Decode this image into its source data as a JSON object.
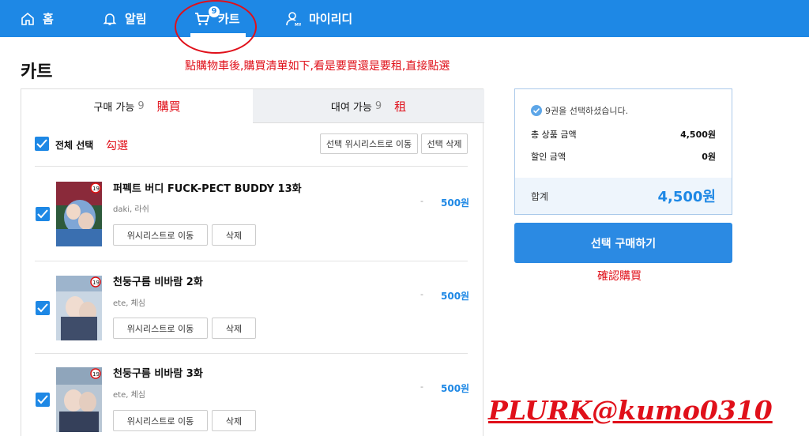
{
  "nav": {
    "home": "홈",
    "alarm": "알림",
    "cart": "카트",
    "cart_badge": "9",
    "my": "마이리디"
  },
  "page": {
    "title": "카트",
    "annotation_top": "點購物車後,購買清單如下,看是要買還是要租,直接點選"
  },
  "tabs": [
    {
      "label": "구매 가능",
      "count": "9",
      "annotation": "購買"
    },
    {
      "label": "대여 가능",
      "count": "9",
      "annotation": "租"
    }
  ],
  "toolbar": {
    "select_all": "전체 선택",
    "annotation_check": "勾選",
    "move_wishlist": "선택 위시리스트로 이동",
    "delete_selected": "선택 삭제"
  },
  "items": [
    {
      "title": "퍼펙트 버디 FUCK-PECT BUDDY 13화",
      "author": "daki, 라쉬",
      "dash": "-",
      "price": "500원",
      "wish_btn": "위시리스트로 이동",
      "delete_btn": "삭제"
    },
    {
      "title": "천둥구름 비바람 2화",
      "author": "ete, 체심",
      "dash": "-",
      "price": "500원",
      "wish_btn": "위시리스트로 이동",
      "delete_btn": "삭제"
    },
    {
      "title": "천둥구름 비바람 3화",
      "author": "ete, 체심",
      "dash": "-",
      "price": "500원",
      "wish_btn": "위시리스트로 이동",
      "delete_btn": "삭제"
    }
  ],
  "summary": {
    "selected_text": "9권을 선택하셨습니다.",
    "total_label": "총 상품 금액",
    "total_value": "4,500원",
    "discount_label": "할인 금액",
    "discount_value": "0원",
    "sum_label": "합계",
    "sum_value": "4,500원"
  },
  "buy_button": "선택 구매하기",
  "annotation_buy": "確認購買",
  "watermark": "PLURK@kumo0310",
  "colors": {
    "primary": "#1e88e5",
    "annotation": "#e0101a"
  }
}
